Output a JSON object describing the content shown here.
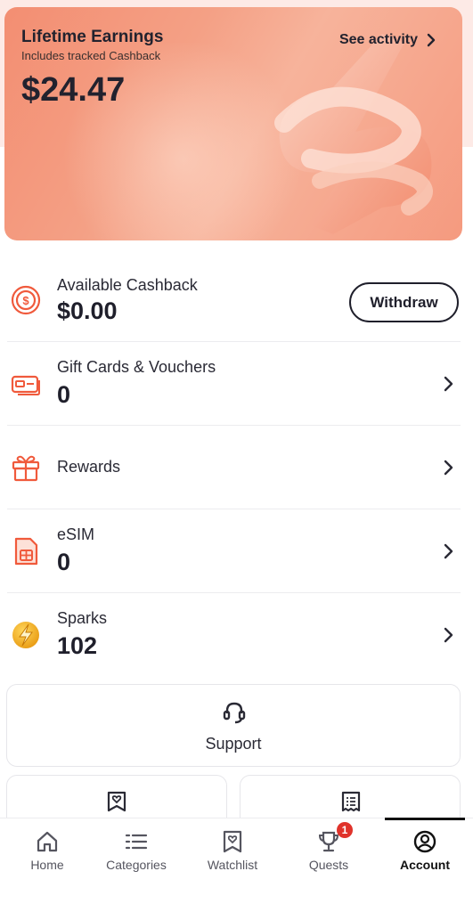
{
  "earnings": {
    "title": "Lifetime Earnings",
    "subtitle": "Includes tracked Cashback",
    "amount": "$24.47",
    "see_activity": "See activity"
  },
  "rows": [
    {
      "title": "Available Cashback",
      "value": "$0.00",
      "action": "Withdraw",
      "icon": "cashback-coin-icon"
    },
    {
      "title": "Gift Cards & Vouchers",
      "value": "0",
      "icon": "gift-card-icon"
    },
    {
      "title": "Rewards",
      "value": "",
      "icon": "gift-box-icon"
    },
    {
      "title": "eSIM",
      "value": "0",
      "icon": "sim-card-icon"
    },
    {
      "title": "Sparks",
      "value": "102",
      "icon": "sparks-coin-icon"
    }
  ],
  "support": {
    "label": "Support",
    "icon": "headset-icon"
  },
  "tabs": [
    {
      "label": "Home",
      "icon": "home-icon"
    },
    {
      "label": "Categories",
      "icon": "list-icon"
    },
    {
      "label": "Watchlist",
      "icon": "watchlist-icon"
    },
    {
      "label": "Quests",
      "icon": "trophy-icon",
      "badge": "1"
    },
    {
      "label": "Account",
      "icon": "account-icon",
      "active": true
    }
  ],
  "colors": {
    "accent": "#f05a3c",
    "badge": "#e0332b",
    "text": "#1f1f2b"
  }
}
